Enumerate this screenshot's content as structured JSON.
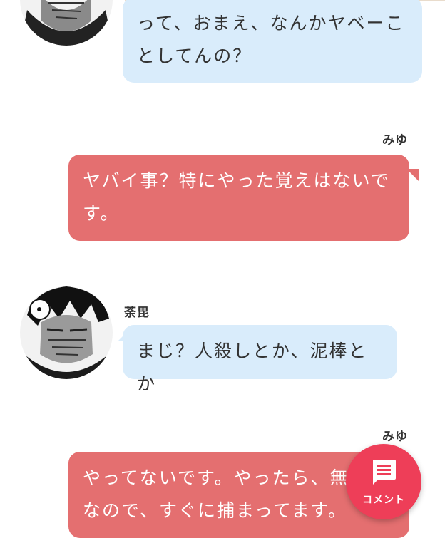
{
  "messages": [
    {
      "sender": "",
      "side": "left",
      "text_lines": [
        "って、おまえ、なんかヤベーこ",
        "としてんの？"
      ]
    },
    {
      "sender": "みゆ",
      "side": "right",
      "text_lines": [
        "ヤバイ事？特にやった覚えはないで",
        "す。"
      ]
    },
    {
      "sender": "荼毘",
      "side": "left",
      "text_lines": [
        "まじ？人殺しとか、泥棒とか"
      ]
    },
    {
      "sender": "みゆ",
      "side": "right",
      "text_lines": [
        "やってないです。やったら、無",
        "なので、すぐに捕まってます。"
      ]
    }
  ],
  "fab": {
    "label": "コメント",
    "icon": "comment-icon"
  },
  "colors": {
    "left_bubble": "#d9ecfb",
    "right_bubble": "#e46f70",
    "fab": "#ee3e58"
  }
}
